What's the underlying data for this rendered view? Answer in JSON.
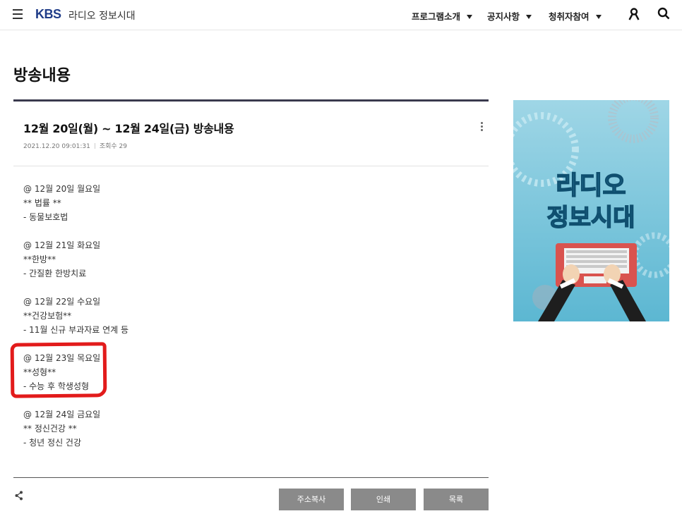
{
  "header": {
    "logo": "KBS",
    "site_title": "라디오 정보시대",
    "nav": [
      {
        "label": "프로그램소개"
      },
      {
        "label": "공지사항"
      },
      {
        "label": "청취자참여"
      }
    ]
  },
  "page": {
    "title": "방송내용"
  },
  "article": {
    "title": "12월 20일(월) ~ 12월 24일(금) 방송내용",
    "date": "2021.12.20 09:01:31",
    "views": "조회수 29",
    "days": [
      {
        "date": "@ 12월 20일 월요일",
        "topic": "** 법률 **",
        "detail": "- 동물보호법"
      },
      {
        "date": "@ 12월 21일 화요일",
        "topic": "**한방**",
        "detail": "- 간질환 한방치료"
      },
      {
        "date": "@ 12월 22일 수요일",
        "topic": "**건강보험**",
        "detail": "- 11월 신규 부과자료 연계 등"
      },
      {
        "date": "@ 12월 23일 목요일",
        "topic": "**성형**",
        "detail": "- 수능 후 학생성형"
      },
      {
        "date": "@ 12월 24일 금요일",
        "topic": "** 정신건강 **",
        "detail": "- 청년 정신 건강"
      }
    ]
  },
  "buttons": {
    "copy_url": "주소복사",
    "print": "인쇄",
    "list": "목록"
  },
  "banner": {
    "line1": "라디오",
    "line2": "정보시대"
  },
  "colors": {
    "brand": "#1f3c88",
    "highlight": "#e21b1b",
    "button_bg": "#8a8a8a",
    "banner_bg": "#7ec8df"
  }
}
